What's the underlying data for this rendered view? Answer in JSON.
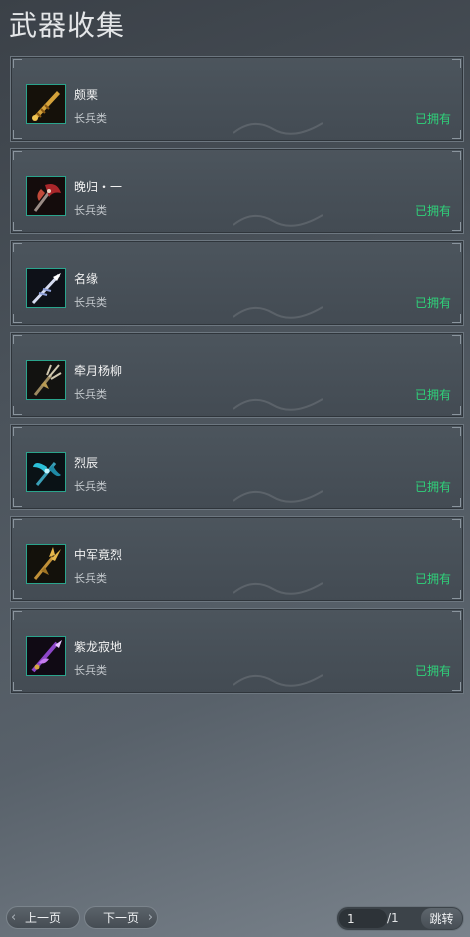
{
  "title": "武器收集",
  "weapons": [
    {
      "name": "颇栗",
      "category": "长兵类",
      "status": "已拥有",
      "icon": "golden-blade-icon"
    },
    {
      "name": "晚归・一",
      "category": "长兵类",
      "status": "已拥有",
      "icon": "red-axe-icon"
    },
    {
      "name": "名缘",
      "category": "长兵类",
      "status": "已拥有",
      "icon": "silver-spear-icon"
    },
    {
      "name": "牵月杨柳",
      "category": "长兵类",
      "status": "已拥有",
      "icon": "trident-icon"
    },
    {
      "name": "烈辰",
      "category": "长兵类",
      "status": "已拥有",
      "icon": "teal-wing-blade-icon"
    },
    {
      "name": "中军竟烈",
      "category": "长兵类",
      "status": "已拥有",
      "icon": "gold-halberd-icon"
    },
    {
      "name": "紫龙寂地",
      "category": "长兵类",
      "status": "已拥有",
      "icon": "purple-dragon-spear-icon"
    }
  ],
  "pager": {
    "prev_label": "上一页",
    "next_label": "下一页",
    "current_page": "1",
    "total_label": "/1",
    "jump_label": "跳转"
  },
  "colors": {
    "owned": "#2fd27a",
    "icon_border": "#2aa48c"
  }
}
